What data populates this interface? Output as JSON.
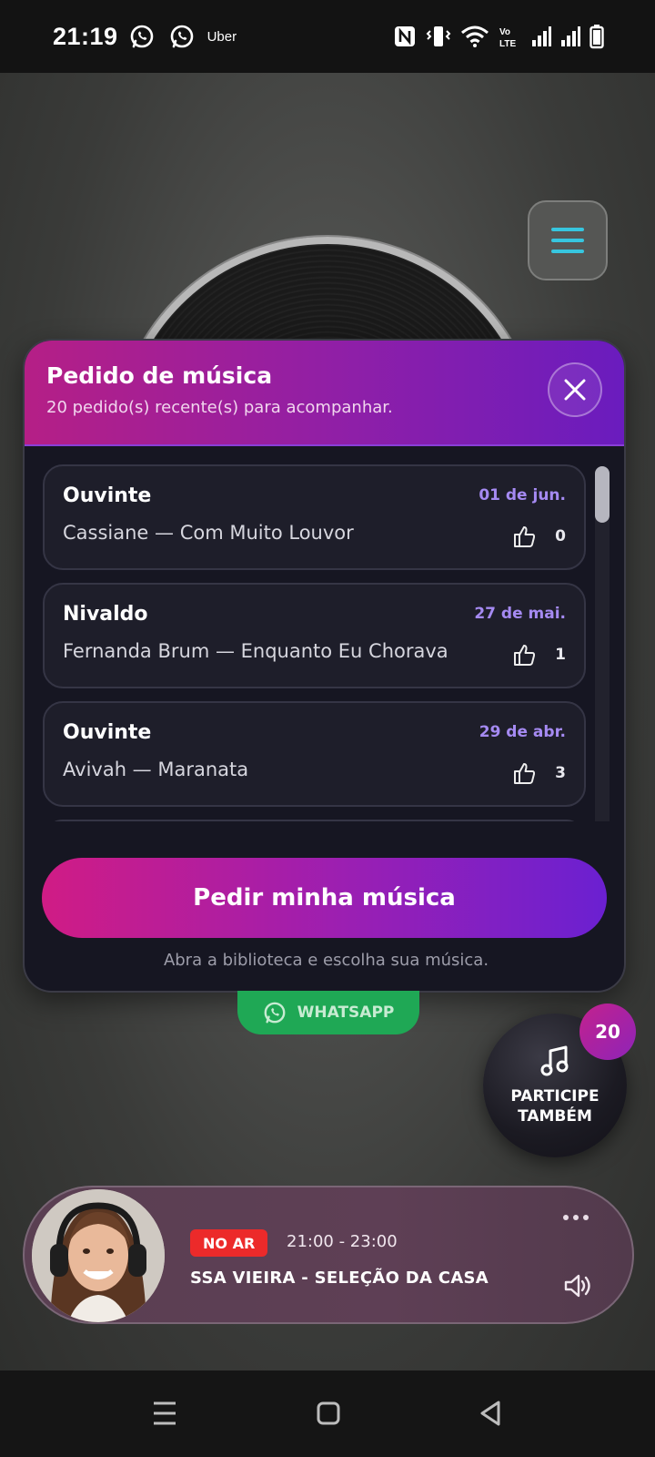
{
  "status_bar": {
    "time": "21:19",
    "notification_icons": [
      "whatsapp-icon",
      "whatsapp-icon"
    ],
    "app_label": "Uber",
    "system_icons": [
      "nfc-icon",
      "vibrate-icon",
      "wifi-icon",
      "volte-icon",
      "signal-icon",
      "signal-icon",
      "battery-icon"
    ],
    "volte_label": "Vo LTE2"
  },
  "header": {
    "menu_icon": "hamburger-icon"
  },
  "modal": {
    "title": "Pedido de música",
    "subtitle": "20 pedido(s) recente(s) para acompanhar.",
    "close_icon": "close-icon",
    "requests": [
      {
        "name": "Ouvinte",
        "date": "01 de jun.",
        "song": "Cassiane — Com Muito Louvor",
        "likes": "0"
      },
      {
        "name": "Nivaldo",
        "date": "27 de mai.",
        "song": "Fernanda Brum — Enquanto Eu Chorava",
        "likes": "1"
      },
      {
        "name": "Ouvinte",
        "date": "29 de abr.",
        "song": "Avivah — Maranata",
        "likes": "3"
      }
    ],
    "request_button_label": "Pedir minha música",
    "request_hint": "Abra a biblioteca e escolha sua música."
  },
  "whatsapp_button": {
    "label": "WHATSAPP",
    "icon": "whatsapp-icon"
  },
  "participate": {
    "label_line1": "PARTICIPE",
    "label_line2": "TAMBÉM",
    "icon": "music-note-icon",
    "badge_count": "20"
  },
  "player": {
    "live_label": "NO AR",
    "time_range": "21:00 - 23:00",
    "show_name": "SSA VIEIRA - SELEÇÃO DA CASA",
    "more_icon": "more-icon",
    "volume_icon": "volume-icon"
  },
  "nav_bar": {
    "items": [
      "menu-icon",
      "home-icon",
      "back-icon"
    ]
  },
  "colors": {
    "accent_pink": "#d01c85",
    "accent_purple": "#6b20d1",
    "date_purple": "#a58af2",
    "menu_cyan": "#37c6df",
    "live_red": "#ec2a2a",
    "whatsapp_green": "#1fa855"
  }
}
